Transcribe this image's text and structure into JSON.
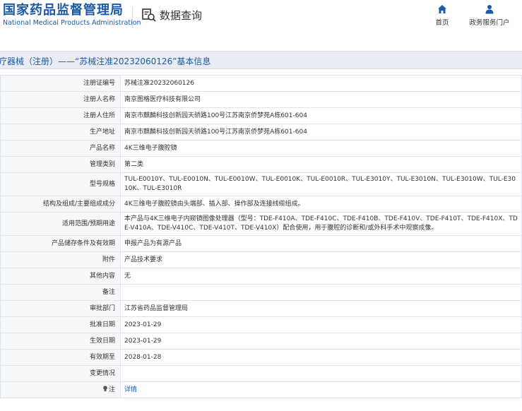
{
  "header": {
    "logo_cn": "国家药品监督管理局",
    "logo_en": "National Medical Products Administration",
    "query_icon": "search-document-icon",
    "query_label": "数据查询",
    "nav": [
      {
        "label": "首页",
        "icon": "home-icon"
      },
      {
        "label": "政务服务门户",
        "icon": "user-icon"
      }
    ]
  },
  "title": "疗器械（注册）——“苏械注准20232060126”基本信息",
  "colors": {
    "brand": "#1a5aa6",
    "label_bg": "#f6f7f9",
    "titlebar_bg": "#e9edf3"
  },
  "rows": [
    {
      "label": "注册证编号",
      "value": "苏械注准20232060126"
    },
    {
      "label": "注册人名称",
      "value": "南京图格医疗科技有限公司"
    },
    {
      "label": "注册人住所",
      "value": "南京市麒麟科技创新园天骄路100号江苏南京侨梦苑A栋601-604"
    },
    {
      "label": "生产地址",
      "value": "南京市麒麟科技创新园天骄路100号江苏南京侨梦苑A栋601-604"
    },
    {
      "label": "产品名称",
      "value": "4K三维电子腹腔镜"
    },
    {
      "label": "管理类别",
      "value": "第二类"
    },
    {
      "label": "型号规格",
      "value": "TUL-E0010Y、TUL-E0010N、TUL-E0010W、TUL-E0010K、TUL-E0010R、TUL-E3010Y、TUL-E3010N、TUL-E3010W、TUL-E3010K、TUL-E3010R"
    },
    {
      "label": "结构及组成/主要组成成分",
      "value": "4K三维电子腹腔镜由头端部、插入部、操作部及连接线缆组成。"
    },
    {
      "label": "适用范围/预期用途",
      "value": "本产品与4K三维电子内窥镜图像处理器（型号：TDE-F410A、TDE-F410C、TDE-F410B、TDE-F410V、TDE-F410T、TDE-F410X、TDE-V410A、TDE-V410C、TDE-V410T、TDE-V410X）配合使用，用于腹腔的诊断和/或外科手术中观察成像。"
    },
    {
      "label": "产品储存条件及有效期",
      "value": "申报产品为有源产品"
    },
    {
      "label": "附件",
      "value": "产品技术要求"
    },
    {
      "label": "其他内容",
      "value": "无"
    },
    {
      "label": "备注",
      "value": ""
    },
    {
      "label": "审批部门",
      "value": "江苏省药品监督管理局"
    },
    {
      "label": "批准日期",
      "value": "2023-01-29"
    },
    {
      "label": "生效日期",
      "value": "2023-01-29"
    },
    {
      "label": "有效期至",
      "value": "2028-01-28"
    },
    {
      "label": "变更情况",
      "value": ""
    }
  ],
  "note_row": {
    "label": "注",
    "icon": "lightbulb-icon",
    "link": "详情"
  }
}
